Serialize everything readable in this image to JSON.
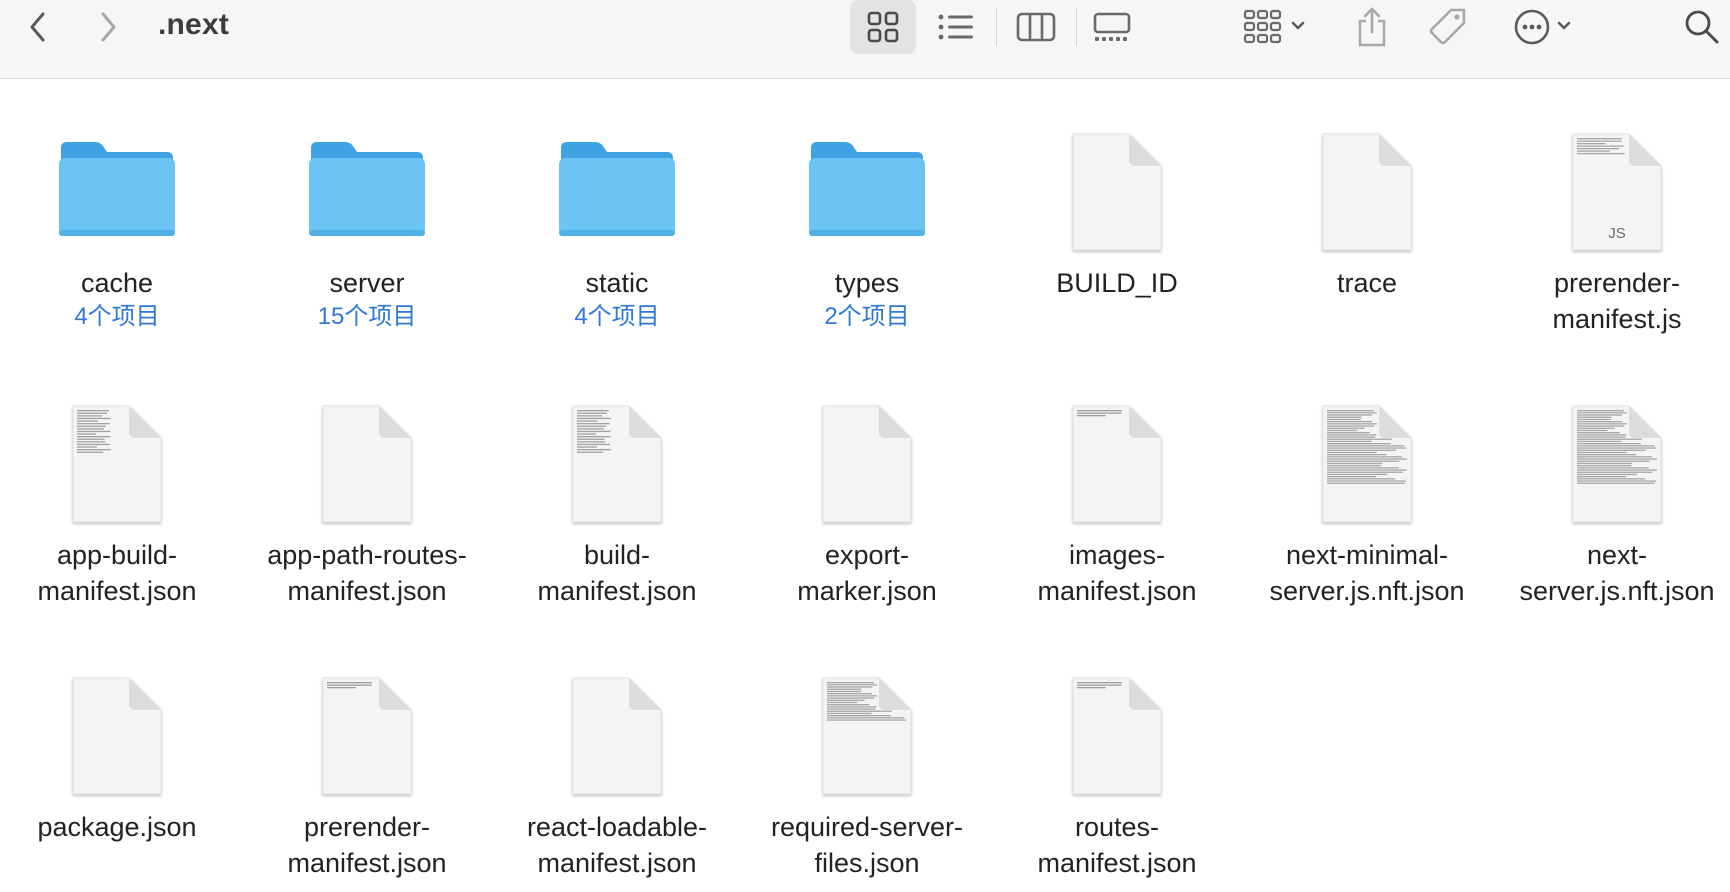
{
  "window": {
    "title": ".next"
  },
  "toolbar": {
    "back_icon": "chevron-left-icon",
    "forward_icon": "chevron-right-icon",
    "views": [
      "icon-view-icon",
      "list-view-icon",
      "column-view-icon",
      "gallery-view-icon"
    ],
    "selected_view": "icon-view-icon",
    "group_icon": "group-by-icon",
    "share_icon": "share-icon",
    "tag_icon": "tag-icon",
    "more_icon": "more-actions-icon",
    "search_icon": "search-icon"
  },
  "colors": {
    "folder_body": "#6cc4f2",
    "folder_tab": "#3fa3e3",
    "subtitle": "#2f78d6",
    "toolbar_bg": "#f6f6f6"
  },
  "items": [
    {
      "name": "cache",
      "kind": "folder",
      "count": "4个项目"
    },
    {
      "name": "server",
      "kind": "folder",
      "count": "15个项目"
    },
    {
      "name": "static",
      "kind": "folder",
      "count": "4个项目"
    },
    {
      "name": "types",
      "kind": "folder",
      "count": "2个项目"
    },
    {
      "name": "BUILD_ID",
      "kind": "file"
    },
    {
      "name": "trace",
      "kind": "file"
    },
    {
      "name": "prerender-manifest.js",
      "kind": "js",
      "badge": "JS"
    },
    {
      "name": "app-build-manifest.json",
      "kind": "file-text"
    },
    {
      "name": "app-path-routes-manifest.json",
      "kind": "file"
    },
    {
      "name": "build-manifest.json",
      "kind": "file-text"
    },
    {
      "name": "export-marker.json",
      "kind": "file"
    },
    {
      "name": "images-manifest.json",
      "kind": "file-topline"
    },
    {
      "name": "next-minimal-server.js.nft.json",
      "kind": "file-dense"
    },
    {
      "name": "next-server.js.nft.json",
      "kind": "file-dense"
    },
    {
      "name": "package.json",
      "kind": "file"
    },
    {
      "name": "prerender-manifest.json",
      "kind": "file-topline"
    },
    {
      "name": "react-loadable-manifest.json",
      "kind": "file"
    },
    {
      "name": "required-server-files.json",
      "kind": "file-half"
    },
    {
      "name": "routes-manifest.json",
      "kind": "file-topline"
    }
  ],
  "labels": [
    [
      "cache"
    ],
    [
      "server"
    ],
    [
      "static"
    ],
    [
      "types"
    ],
    [
      "BUILD_ID"
    ],
    [
      "trace"
    ],
    [
      "prerender-",
      "manifest.js"
    ],
    [
      "app-build-",
      "manifest.json"
    ],
    [
      "app-path-routes-",
      "manifest.json"
    ],
    [
      "build-",
      "manifest.json"
    ],
    [
      "export-",
      "marker.json"
    ],
    [
      "images-",
      "manifest.json"
    ],
    [
      "next-minimal-",
      "server.js.nft.json"
    ],
    [
      "next-",
      "server.js.nft.json"
    ],
    [
      "package.json"
    ],
    [
      "prerender-",
      "manifest.json"
    ],
    [
      "react-loadable-",
      "manifest.json"
    ],
    [
      "required-server-",
      "files.json"
    ],
    [
      "routes-",
      "manifest.json"
    ]
  ]
}
